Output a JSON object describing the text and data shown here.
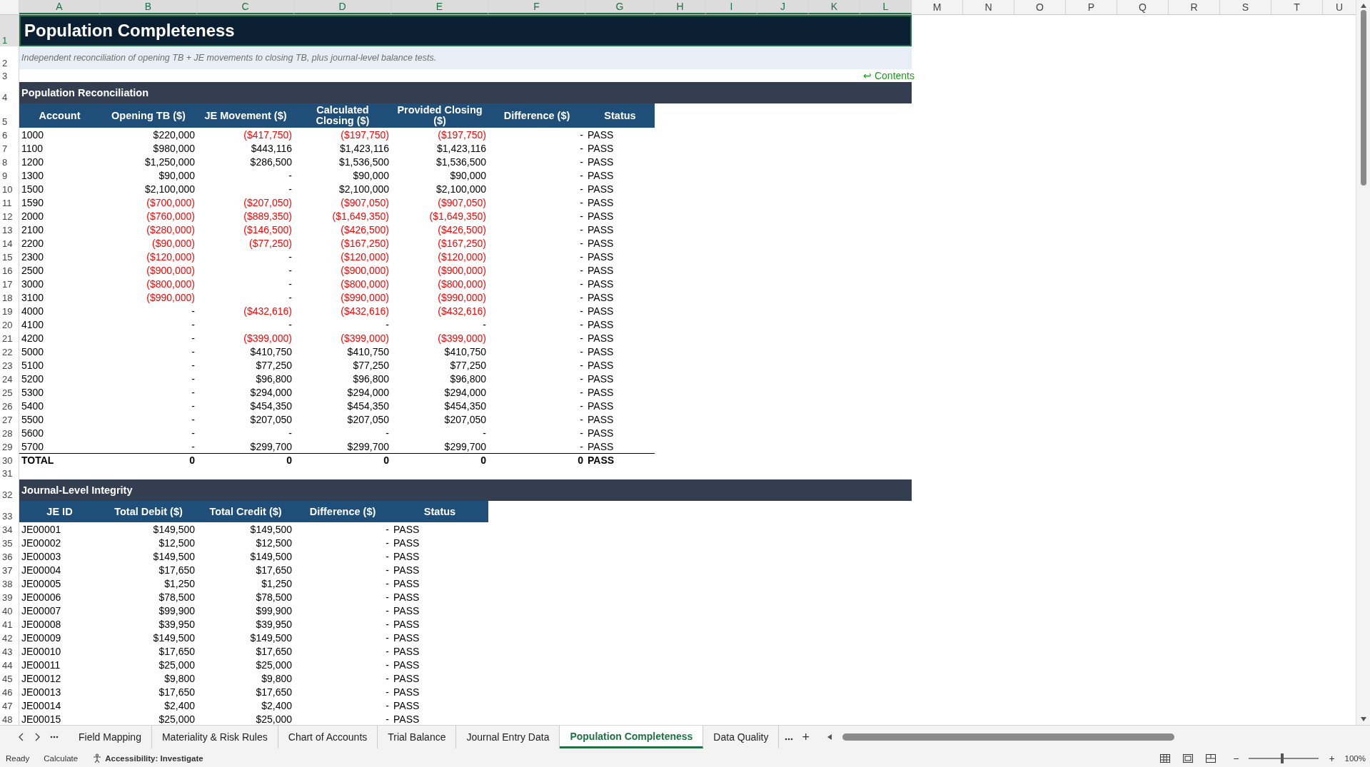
{
  "column_headers": [
    {
      "label": "A",
      "selected": true
    },
    {
      "label": "B",
      "selected": true
    },
    {
      "label": "C",
      "selected": true
    },
    {
      "label": "D",
      "selected": true
    },
    {
      "label": "E",
      "selected": true
    },
    {
      "label": "F",
      "selected": true
    },
    {
      "label": "G",
      "selected": true
    },
    {
      "label": "H",
      "selected": true
    },
    {
      "label": "I",
      "selected": true
    },
    {
      "label": "J",
      "selected": true
    },
    {
      "label": "K",
      "selected": true
    },
    {
      "label": "L",
      "selected": true
    },
    {
      "label": "M",
      "selected": false
    },
    {
      "label": "N",
      "selected": false
    },
    {
      "label": "O",
      "selected": false
    },
    {
      "label": "P",
      "selected": false
    },
    {
      "label": "Q",
      "selected": false
    },
    {
      "label": "R",
      "selected": false
    },
    {
      "label": "S",
      "selected": false
    },
    {
      "label": "T",
      "selected": false
    },
    {
      "label": "U",
      "selected": false
    }
  ],
  "title": {
    "row": "1",
    "text": "Population Completeness",
    "selected": true
  },
  "subtitle": {
    "row": "2",
    "text": "Independent reconciliation of opening TB + JE movements to closing TB, plus journal-level balance tests."
  },
  "contents_link": {
    "row": "3",
    "text": "↩ Contents"
  },
  "reconciliation": {
    "heading_row": "4",
    "heading": "Population Reconciliation",
    "header_row": "5",
    "columns": [
      "Account",
      "Opening TB ($)",
      "JE Movement ($)",
      "Calculated Closing ($)",
      "Provided Closing ($)",
      "Difference ($)",
      "Status"
    ],
    "rows": [
      {
        "row": "6",
        "cells": [
          "1000",
          "$220,000",
          "($417,750)",
          "($197,750)",
          "($197,750)",
          "-",
          "PASS"
        ]
      },
      {
        "row": "7",
        "cells": [
          "1100",
          "$980,000",
          "$443,116",
          "$1,423,116",
          "$1,423,116",
          "-",
          "PASS"
        ]
      },
      {
        "row": "8",
        "cells": [
          "1200",
          "$1,250,000",
          "$286,500",
          "$1,536,500",
          "$1,536,500",
          "-",
          "PASS"
        ]
      },
      {
        "row": "9",
        "cells": [
          "1300",
          "$90,000",
          "-",
          "$90,000",
          "$90,000",
          "-",
          "PASS"
        ]
      },
      {
        "row": "10",
        "cells": [
          "1500",
          "$2,100,000",
          "-",
          "$2,100,000",
          "$2,100,000",
          "-",
          "PASS"
        ]
      },
      {
        "row": "11",
        "cells": [
          "1590",
          "($700,000)",
          "($207,050)",
          "($907,050)",
          "($907,050)",
          "-",
          "PASS"
        ]
      },
      {
        "row": "12",
        "cells": [
          "2000",
          "($760,000)",
          "($889,350)",
          "($1,649,350)",
          "($1,649,350)",
          "-",
          "PASS"
        ]
      },
      {
        "row": "13",
        "cells": [
          "2100",
          "($280,000)",
          "($146,500)",
          "($426,500)",
          "($426,500)",
          "-",
          "PASS"
        ]
      },
      {
        "row": "14",
        "cells": [
          "2200",
          "($90,000)",
          "($77,250)",
          "($167,250)",
          "($167,250)",
          "-",
          "PASS"
        ]
      },
      {
        "row": "15",
        "cells": [
          "2300",
          "($120,000)",
          "-",
          "($120,000)",
          "($120,000)",
          "-",
          "PASS"
        ]
      },
      {
        "row": "16",
        "cells": [
          "2500",
          "($900,000)",
          "-",
          "($900,000)",
          "($900,000)",
          "-",
          "PASS"
        ]
      },
      {
        "row": "17",
        "cells": [
          "3000",
          "($800,000)",
          "-",
          "($800,000)",
          "($800,000)",
          "-",
          "PASS"
        ]
      },
      {
        "row": "18",
        "cells": [
          "3100",
          "($990,000)",
          "-",
          "($990,000)",
          "($990,000)",
          "-",
          "PASS"
        ]
      },
      {
        "row": "19",
        "cells": [
          "4000",
          "-",
          "($432,616)",
          "($432,616)",
          "($432,616)",
          "-",
          "PASS"
        ]
      },
      {
        "row": "20",
        "cells": [
          "4100",
          "-",
          "-",
          "-",
          "-",
          "-",
          "PASS"
        ]
      },
      {
        "row": "21",
        "cells": [
          "4200",
          "-",
          "($399,000)",
          "($399,000)",
          "($399,000)",
          "-",
          "PASS"
        ]
      },
      {
        "row": "22",
        "cells": [
          "5000",
          "-",
          "$410,750",
          "$410,750",
          "$410,750",
          "-",
          "PASS"
        ]
      },
      {
        "row": "23",
        "cells": [
          "5100",
          "-",
          "$77,250",
          "$77,250",
          "$77,250",
          "-",
          "PASS"
        ]
      },
      {
        "row": "24",
        "cells": [
          "5200",
          "-",
          "$96,800",
          "$96,800",
          "$96,800",
          "-",
          "PASS"
        ]
      },
      {
        "row": "25",
        "cells": [
          "5300",
          "-",
          "$294,000",
          "$294,000",
          "$294,000",
          "-",
          "PASS"
        ]
      },
      {
        "row": "26",
        "cells": [
          "5400",
          "-",
          "$454,350",
          "$454,350",
          "$454,350",
          "-",
          "PASS"
        ]
      },
      {
        "row": "27",
        "cells": [
          "5500",
          "-",
          "$207,050",
          "$207,050",
          "$207,050",
          "-",
          "PASS"
        ]
      },
      {
        "row": "28",
        "cells": [
          "5600",
          "-",
          "-",
          "-",
          "-",
          "-",
          "PASS"
        ]
      },
      {
        "row": "29",
        "cells": [
          "5700",
          "-",
          "$299,700",
          "$299,700",
          "$299,700",
          "-",
          "PASS"
        ]
      }
    ],
    "total": {
      "row": "30",
      "cells": [
        "TOTAL",
        "0",
        "0",
        "0",
        "0",
        "0",
        "PASS"
      ]
    }
  },
  "blank_row": "31",
  "journal": {
    "heading_row": "32",
    "heading": "Journal-Level Integrity",
    "header_row": "33",
    "columns": [
      "JE ID",
      "Total Debit ($)",
      "Total Credit ($)",
      "Difference ($)",
      "Status"
    ],
    "rows": [
      {
        "row": "34",
        "cells": [
          "JE00001",
          "$149,500",
          "$149,500",
          "-",
          "PASS"
        ]
      },
      {
        "row": "35",
        "cells": [
          "JE00002",
          "$12,500",
          "$12,500",
          "-",
          "PASS"
        ]
      },
      {
        "row": "36",
        "cells": [
          "JE00003",
          "$149,500",
          "$149,500",
          "-",
          "PASS"
        ]
      },
      {
        "row": "37",
        "cells": [
          "JE00004",
          "$17,650",
          "$17,650",
          "-",
          "PASS"
        ]
      },
      {
        "row": "38",
        "cells": [
          "JE00005",
          "$1,250",
          "$1,250",
          "-",
          "PASS"
        ]
      },
      {
        "row": "39",
        "cells": [
          "JE00006",
          "$78,500",
          "$78,500",
          "-",
          "PASS"
        ]
      },
      {
        "row": "40",
        "cells": [
          "JE00007",
          "$99,900",
          "$99,900",
          "-",
          "PASS"
        ]
      },
      {
        "row": "41",
        "cells": [
          "JE00008",
          "$39,950",
          "$39,950",
          "-",
          "PASS"
        ]
      },
      {
        "row": "42",
        "cells": [
          "JE00009",
          "$149,500",
          "$149,500",
          "-",
          "PASS"
        ]
      },
      {
        "row": "43",
        "cells": [
          "JE00010",
          "$17,650",
          "$17,650",
          "-",
          "PASS"
        ]
      },
      {
        "row": "44",
        "cells": [
          "JE00011",
          "$25,000",
          "$25,000",
          "-",
          "PASS"
        ]
      },
      {
        "row": "45",
        "cells": [
          "JE00012",
          "$9,800",
          "$9,800",
          "-",
          "PASS"
        ]
      },
      {
        "row": "46",
        "cells": [
          "JE00013",
          "$17,650",
          "$17,650",
          "-",
          "PASS"
        ]
      },
      {
        "row": "47",
        "cells": [
          "JE00014",
          "$2,400",
          "$2,400",
          "-",
          "PASS"
        ]
      },
      {
        "row": "48",
        "cells": [
          "JE00015",
          "$25,000",
          "$25,000",
          "-",
          "PASS"
        ]
      }
    ]
  },
  "sheet_tabs": [
    {
      "label": "Field Mapping",
      "selected": false
    },
    {
      "label": "Materiality & Risk Rules",
      "selected": false
    },
    {
      "label": "Chart of Accounts",
      "selected": false
    },
    {
      "label": "Trial Balance",
      "selected": false
    },
    {
      "label": "Journal Entry Data",
      "selected": false
    },
    {
      "label": "Population Completeness",
      "selected": true
    },
    {
      "label": "Data Quality",
      "selected": false
    }
  ],
  "add_sheet": "+",
  "status_bar": {
    "ready": "Ready",
    "calculate": "Calculate",
    "accessibility": "Accessibility: Investigate",
    "zoom_out": "−",
    "zoom_in": "+",
    "zoom_level": {
      "level": 0.48
    },
    "zoom_text": "100%"
  }
}
